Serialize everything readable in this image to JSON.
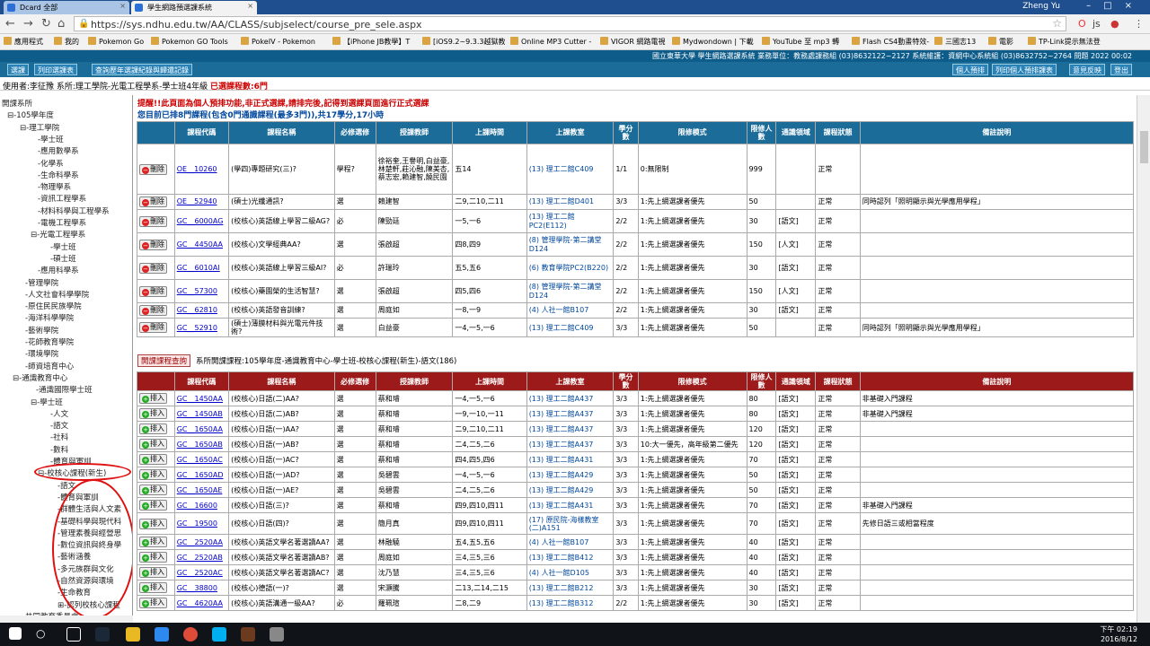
{
  "browser": {
    "tabs": [
      "Dcard 全部",
      "學生網路預選課系統"
    ],
    "user": "Zheng Yu",
    "url": "https://sys.ndhu.edu.tw/AA/CLASS/subjselect/course_pre_sele.aspx",
    "bookmarks": [
      "應用程式",
      "我的",
      "Pokemon Go",
      "Pokemon GO Tools",
      "PokeIV - Pokemon",
      "【iPhone JB教學】T",
      "[iOS9.2~9.3.3越獄教",
      "Online MP3 Cutter -",
      "VIGOR 網路電視",
      "Mydwondown | 下載",
      "YouTube 至 mp3 轉",
      "Flash CS4動畫特效-",
      "三國志13",
      "電影",
      "TP-Link提示無法登"
    ]
  },
  "header": {
    "system_info": "國立東華大學 學生網路選課系統 業務單位：教務處課務組 (03)8632122~2127 系統維護：資網中心系統組 (03)8632752~2764 問題 2022 00:02",
    "left_buttons": [
      "選課",
      "列印選課表",
      "查詢歷年選課紀錄與歸還記錄"
    ],
    "right_buttons": [
      "個人預排",
      "列印個人預排課表",
      "意見反映",
      "登出"
    ],
    "user_line": "使用者:李征豫 系所:理工學院-光電工程學系-學士班4年級",
    "selected_count": "已選課程數:6門"
  },
  "tree": [
    "開課系所",
    "⊟-105學年度",
    "⊟-理工學院",
    "-學士班",
    "-應用數學系",
    "-化學系",
    "-生命科學系",
    "-物理學系",
    "-資訊工程學系",
    "-材料科學與工程學系",
    "-電機工程學系",
    "⊟-光電工程學系",
    "-學士班",
    "-碩士班",
    "-應用科學系",
    "-管理學院",
    "-人文社會科學學院",
    "-原住民民族學院",
    "-海洋科學學院",
    "-藝術學院",
    "-花師教育學院",
    "-環境學院",
    "-師資培育中心",
    "⊟-通識教育中心",
    "-通識國際學士班",
    "⊟-學士班",
    "-人文",
    "-語文",
    "-社科",
    "-數科",
    "-體育與軍訓",
    "⊟-校核心課程(新生)",
    "-語文",
    "-體育與軍訓",
    "-群體生活與人文素",
    "-基礎科學與現代科",
    "-管理素養與經營思",
    "-數位資訊與終身學",
    "-藝術涵養",
    "-多元族群與文化",
    "-自然資源與環境",
    "-生命教育",
    "⊞-認列校核心課程",
    "共同教育委員會"
  ],
  "notice": "提醒!!此頁面為個人預排功能,非正式選課,請排完後,記得到選課頁面進行正式選課",
  "summary": "您目前已排8門課程(包含0門通識課程(最多3門)),共17學分,17小時",
  "columns": [
    "",
    "課程代碼",
    "課程名稱",
    "必修選修",
    "授課教師",
    "上課時間",
    "上課教室",
    "學分數",
    "限修模式",
    "限修人數",
    "通識領域",
    "課程狀態",
    "備註說明"
  ],
  "delete_label": "刪除",
  "add_label": "排入",
  "selected": [
    [
      "OE__10260",
      "(學四)專題研究(三)?",
      "學程?",
      "徐裕奎,王譽明,白益豪,林楚軒,莊沁融,陳美杏,蔡志宏,賴建智,饒民園",
      "五14",
      "(13) 理工二館C409",
      "1/1",
      "0:無限制",
      "999",
      "",
      "正常",
      ""
    ],
    [
      "OE__52940",
      "(碩士)光纖通訊?",
      "選",
      "賴建智",
      "二9,二10,二11",
      "(13) 理工二館D401",
      "3/3",
      "1:先上網選課者優先",
      "50",
      "",
      "正常",
      "同時認列「照明顯示與光學應用學程」"
    ],
    [
      "GC__6000AG",
      "(校核心)英語線上學習二級AG?",
      "必",
      "陳勁廷",
      "一5,一6",
      "(13) 理工二館PC2(E112)",
      "2/2",
      "1:先上網選課者優先",
      "30",
      "[語文]",
      "正常",
      ""
    ],
    [
      "GC__4450AA",
      "(校核心)文學經典AA?",
      "選",
      "張啟超",
      "四8,四9",
      "(8) 管理學院-第二講堂D124",
      "2/2",
      "1:先上網選課者優先",
      "150",
      "[人文]",
      "正常",
      ""
    ],
    [
      "GC__6010AI",
      "(校核心)英語線上學習三級AI?",
      "必",
      "許瑞玲",
      "五5,五6",
      "(6) 教育學院PC2(B220)",
      "2/2",
      "1:先上網選課者優先",
      "30",
      "[語文]",
      "正常",
      ""
    ],
    [
      "GC__57300",
      "(校核心)藥園榮的生活智慧?",
      "選",
      "張啟超",
      "四5,四6",
      "(8) 管理學院-第二講堂D124",
      "2/2",
      "1:先上網選課者優先",
      "150",
      "[人文]",
      "正常",
      ""
    ],
    [
      "GC__62810",
      "(校核心)英語發音訓練?",
      "選",
      "周庭如",
      "一8,一9",
      "(4) 人社一館B107",
      "2/2",
      "1:先上網選課者優先",
      "30",
      "[語文]",
      "正常",
      ""
    ],
    [
      "GC__52910",
      "(碩士)薄膜材料與光電元件技術?",
      "選",
      "白益豪",
      "一4,一5,一6",
      "(13) 理工二館C409",
      "3/3",
      "1:先上網選課者優先",
      "50",
      "",
      "正常",
      "同時認列「照明顯示與光學應用學程」"
    ]
  ],
  "search": {
    "button": "開課課程查詢",
    "text": "系所開課課程:105學年度-通識教育中心-學士班-校核心課程(新生)-語文(186)"
  },
  "offered": [
    [
      "GC__1450AA",
      "(校核心)日語(二)AA?",
      "選",
      "蔡和璿",
      "一4,一5,一6",
      "(13) 理工二館A437",
      "3/3",
      "1:先上網選課者優先",
      "80",
      "[語文]",
      "正常",
      "非基礎入門課程"
    ],
    [
      "GC__1450AB",
      "(校核心)日語(二)AB?",
      "選",
      "蔡和璿",
      "一9,一10,一11",
      "(13) 理工二館A437",
      "3/3",
      "1:先上網選課者優先",
      "80",
      "[語文]",
      "正常",
      "非基礎入門課程"
    ],
    [
      "GC__1650AA",
      "(校核心)日語(一)AA?",
      "選",
      "蔡和璿",
      "二9,二10,二11",
      "(13) 理工二館A437",
      "3/3",
      "1:先上網選課者優先",
      "120",
      "[語文]",
      "正常",
      ""
    ],
    [
      "GC__1650AB",
      "(校核心)日語(一)AB?",
      "選",
      "蔡和璿",
      "二4,二5,二6",
      "(13) 理工二館A437",
      "3/3",
      "10:大一優先，高年級第二優先",
      "120",
      "[語文]",
      "正常",
      ""
    ],
    [
      "GC__1650AC",
      "(校核心)日語(一)AC?",
      "選",
      "蔡和璿",
      "四4,四5,四6",
      "(13) 理工二館A431",
      "3/3",
      "1:先上網選課者優先",
      "70",
      "[語文]",
      "正常",
      ""
    ],
    [
      "GC__1650AD",
      "(校核心)日語(一)AD?",
      "選",
      "吳碧雲",
      "一4,一5,一6",
      "(13) 理工二館A429",
      "3/3",
      "1:先上網選課者優先",
      "50",
      "[語文]",
      "正常",
      ""
    ],
    [
      "GC__1650AE",
      "(校核心)日語(一)AE?",
      "選",
      "吳碧雲",
      "二4,二5,二6",
      "(13) 理工二館A429",
      "3/3",
      "1:先上網選課者優先",
      "50",
      "[語文]",
      "正常",
      ""
    ],
    [
      "GC__16600",
      "(校核心)日語(三)?",
      "選",
      "蔡和璿",
      "四9,四10,四11",
      "(13) 理工二館A431",
      "3/3",
      "1:先上網選課者優先",
      "70",
      "[語文]",
      "正常",
      "非基礎入門課程"
    ],
    [
      "GC__19500",
      "(校核心)日語(四)?",
      "選",
      "簡月真",
      "四9,四10,四11",
      "(17) 原民院-海樣教室(二)A151",
      "3/3",
      "1:先上網選課者優先",
      "70",
      "[語文]",
      "正常",
      "先修日語三或相當程度"
    ],
    [
      "GC__2520AA",
      "(校核心)英語文學名著選讀AA?",
      "選",
      "林融驍",
      "五4,五5,五6",
      "(4) 人社一館B107",
      "3/3",
      "1:先上網選課者優先",
      "40",
      "[語文]",
      "正常",
      ""
    ],
    [
      "GC__2520AB",
      "(校核心)英語文學名著選讀AB?",
      "選",
      "周庭如",
      "三4,三5,三6",
      "(13) 理工二館B412",
      "3/3",
      "1:先上網選課者優先",
      "40",
      "[語文]",
      "正常",
      ""
    ],
    [
      "GC__2520AC",
      "(校核心)英語文學名著選讀AC?",
      "選",
      "沈乃慧",
      "三4,三5,三6",
      "(4) 人社一館D105",
      "3/3",
      "1:先上網選課者優先",
      "40",
      "[語文]",
      "正常",
      ""
    ],
    [
      "GC__38800",
      "(校核心)德語(一)?",
      "選",
      "宋灝騰",
      "二13,二14,二15",
      "(13) 理工二館B212",
      "3/3",
      "1:先上網選課者優先",
      "30",
      "[語文]",
      "正常",
      ""
    ],
    [
      "GC__4620AA",
      "(校核心)英語溝通一級AA?",
      "必",
      "羅珮瑄",
      "二8,二9",
      "(13) 理工二館B312",
      "2/2",
      "1:先上網選課者優先",
      "30",
      "[語文]",
      "正常",
      ""
    ]
  ],
  "taskbar": {
    "time": "下午 02:19",
    "date": "2016/8/12"
  }
}
